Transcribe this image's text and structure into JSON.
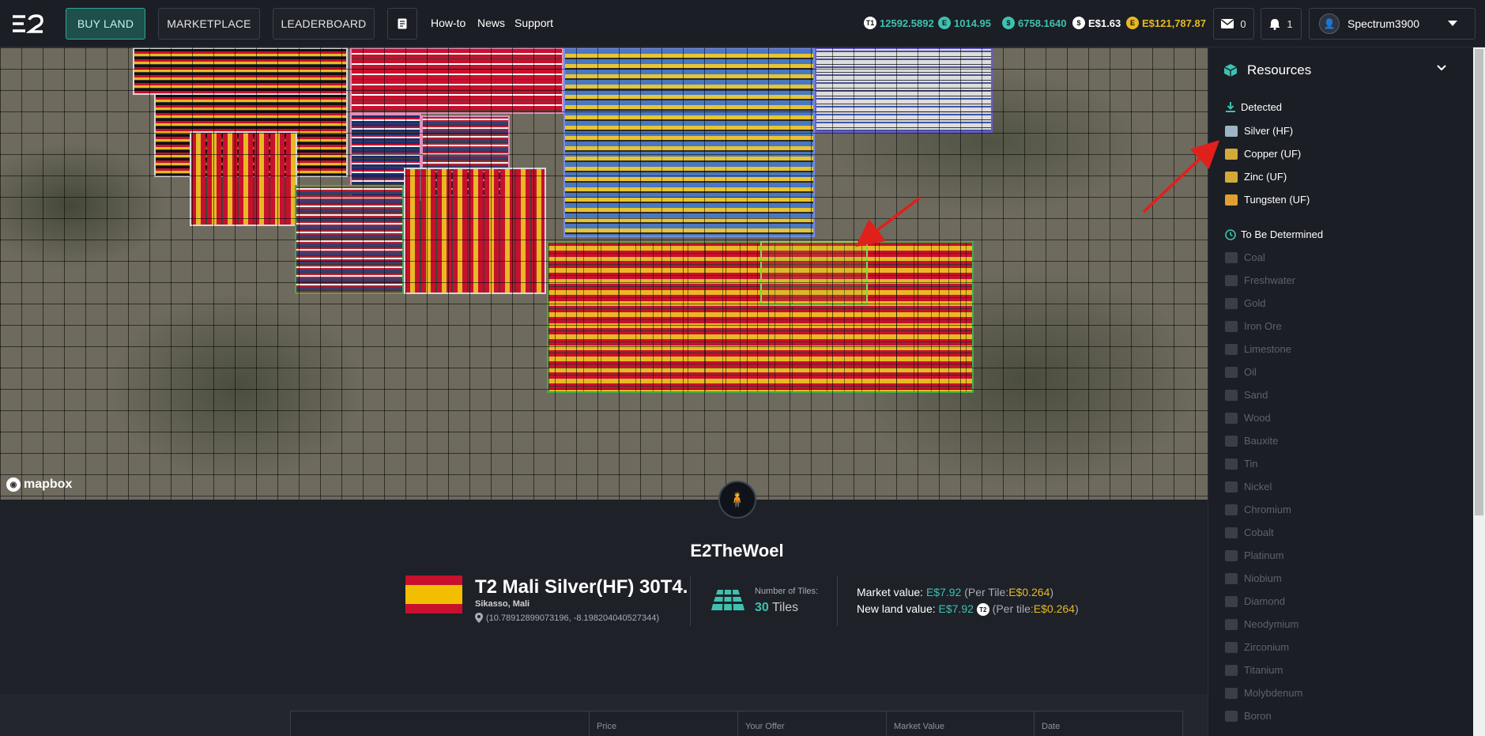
{
  "nav": {
    "buy_land": "BUY LAND",
    "marketplace": "MARKETPLACE",
    "leaderboard": "LEADERBOARD",
    "how_to": "How-to",
    "news": "News",
    "support": "Support"
  },
  "balances": [
    {
      "icon": "t1-coin-icon",
      "glyph": "T1",
      "value": "12592.5892",
      "color": "#3ec1b0"
    },
    {
      "icon": "essence-coin-icon",
      "glyph": "E",
      "value": "1014.95",
      "color": "#3ec1b0"
    },
    {
      "icon": "ether-coin-icon",
      "glyph": "$",
      "value": "6758.1640",
      "color": "#3ec1b0"
    },
    {
      "icon": "dollar-coin-icon",
      "glyph": "$",
      "value": "E$1.63",
      "color": "#ffffff"
    },
    {
      "icon": "gold-coin-icon",
      "glyph": "E",
      "value": "E$121,787.87",
      "color": "#e8b923"
    }
  ],
  "mail_count": "0",
  "notif_count": "1",
  "username": "Spectrum3900",
  "map": {
    "attribution": "mapbox"
  },
  "owner": {
    "name": "E2TheWoel"
  },
  "land": {
    "title": "T2 Mali Silver(HF) 30T4.",
    "location": "Sikasso, Mali",
    "coords": "(10.78912899073196, -8.198204040527344)",
    "tiles_label": "Number of Tiles:",
    "tiles_count": "30",
    "tiles_unit": "Tiles",
    "market_value_label": "Market value:",
    "market_value": "E$7.92",
    "per_tile_open": "(Per Tile:",
    "per_tile_value": "E$0.264",
    "new_land_label": "New land value:",
    "new_land_value": "E$7.92",
    "per_tile_open2": "(Per tile:",
    "per_tile_value2": "E$0.264",
    "t2_badge": "T2",
    "close_paren": ")"
  },
  "table": {
    "headers": [
      "Price",
      "Your Offer",
      "Market Value",
      "Date"
    ]
  },
  "resources": {
    "title": "Resources",
    "detected_label": "Detected",
    "detected": [
      {
        "name": "Silver (HF)",
        "color": "#9fb3c8"
      },
      {
        "name": "Copper (UF)",
        "color": "#d4a93a"
      },
      {
        "name": "Zinc (UF)",
        "color": "#d4a93a"
      },
      {
        "name": "Tungsten (UF)",
        "color": "#e0a030"
      }
    ],
    "tbd_label": "To Be Determined",
    "tbd": [
      "Coal",
      "Freshwater",
      "Gold",
      "Iron Ore",
      "Limestone",
      "Oil",
      "Sand",
      "Wood",
      "Bauxite",
      "Tin",
      "Nickel",
      "Chromium",
      "Cobalt",
      "Platinum",
      "Niobium",
      "Diamond",
      "Neodymium",
      "Zirconium",
      "Titanium",
      "Molybdenum",
      "Boron"
    ]
  }
}
